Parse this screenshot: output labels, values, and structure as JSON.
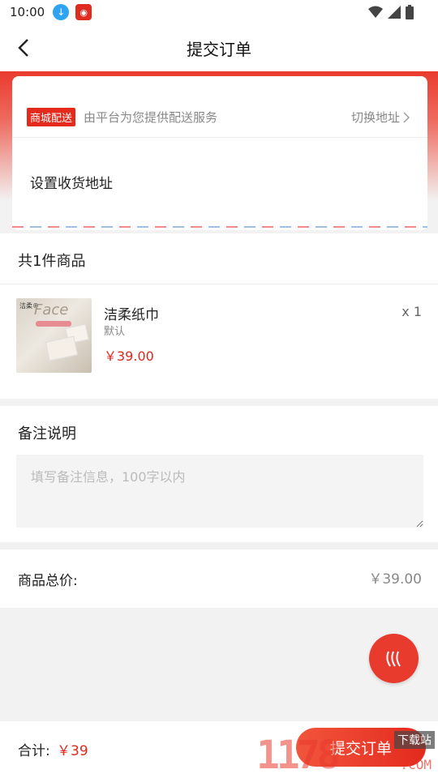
{
  "status_bar": {
    "time": "10:00"
  },
  "nav": {
    "title": "提交订单"
  },
  "address": {
    "badge": "商城配送",
    "delivery_text": "由平台为您提供配送服务",
    "switch_label": "切换地址",
    "set_address": "设置收货地址"
  },
  "goods": {
    "count_label": "共1件商品",
    "items": [
      {
        "name": "洁柔纸巾",
        "spec": "默认",
        "price": "￥39.00",
        "qty": "x 1",
        "thumb_brand": "洁柔®",
        "thumb_face": "Face"
      }
    ]
  },
  "remark": {
    "label": "备注说明",
    "placeholder": "填写备注信息，100字以内"
  },
  "total": {
    "label": "商品总价:",
    "value": "￥39.00"
  },
  "bottom": {
    "sum_label": "合计:",
    "sum_value": "￥39",
    "submit_label": "提交订单"
  },
  "watermark": {
    "number": "1178",
    "tag": "下载站",
    "com": ".COM"
  },
  "colors": {
    "accent": "#e32a1d",
    "background": "#f2f2f2"
  },
  "icons": {
    "back": "chevron-left-icon",
    "float": "heat-wave-icon"
  }
}
